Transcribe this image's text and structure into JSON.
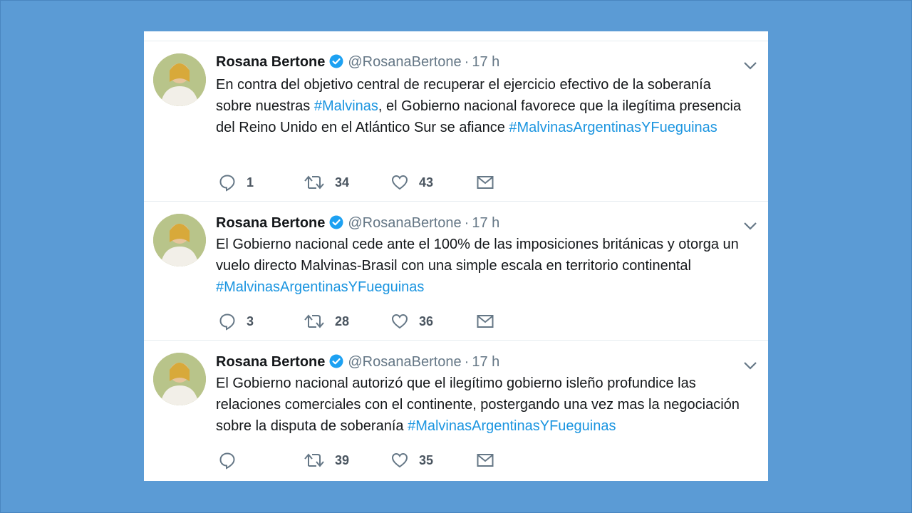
{
  "tweets": [
    {
      "name": "Rosana Bertone",
      "handle": "@RosanaBertone",
      "separator": "·",
      "time": "17 h",
      "text_parts": [
        {
          "t": "En contra del objetivo central de recuperar el ejercicio efectivo de la soberanía sobre nuestras ",
          "tag": false
        },
        {
          "t": "#Malvinas",
          "tag": true
        },
        {
          "t": ", el Gobierno nacional favorece que la ilegítima presencia del Reino Unido en el Atlántico Sur se afiance ",
          "tag": false
        },
        {
          "t": "#MalvinasArgentinasYFueguinas",
          "tag": true
        }
      ],
      "replies": "1",
      "retweets": "34",
      "likes": "43"
    },
    {
      "name": "Rosana Bertone",
      "handle": "@RosanaBertone",
      "separator": "·",
      "time": "17 h",
      "text_parts": [
        {
          "t": "El Gobierno nacional cede ante el 100% de las imposiciones británicas y otorga un vuelo directo Malvinas-Brasil con una simple escala en territorio continental ",
          "tag": false
        },
        {
          "t": "#MalvinasArgentinasYFueguinas",
          "tag": true
        }
      ],
      "replies": "3",
      "retweets": "28",
      "likes": "36"
    },
    {
      "name": "Rosana Bertone",
      "handle": "@RosanaBertone",
      "separator": "·",
      "time": "17 h",
      "text_parts": [
        {
          "t": "El Gobierno nacional autorizó que el ilegítimo gobierno isleño profundice las relaciones comerciales con el continente, postergando una vez mas la negociación sobre la disputa de soberanía ",
          "tag": false
        },
        {
          "t": "#MalvinasArgentinasYFueguinas",
          "tag": true
        }
      ],
      "replies": "",
      "retweets": "39",
      "likes": "35"
    }
  ],
  "icons": {
    "reply": "reply-icon",
    "retweet": "retweet-icon",
    "like": "heart-icon",
    "dm": "envelope-icon",
    "verified": "verified-badge-icon",
    "caret": "chevron-down-icon"
  },
  "colors": {
    "background": "#5B9BD5",
    "hashtag": "#1b95e0",
    "verified": "#1da1f2",
    "text": "#14171a",
    "muted": "#657786"
  }
}
